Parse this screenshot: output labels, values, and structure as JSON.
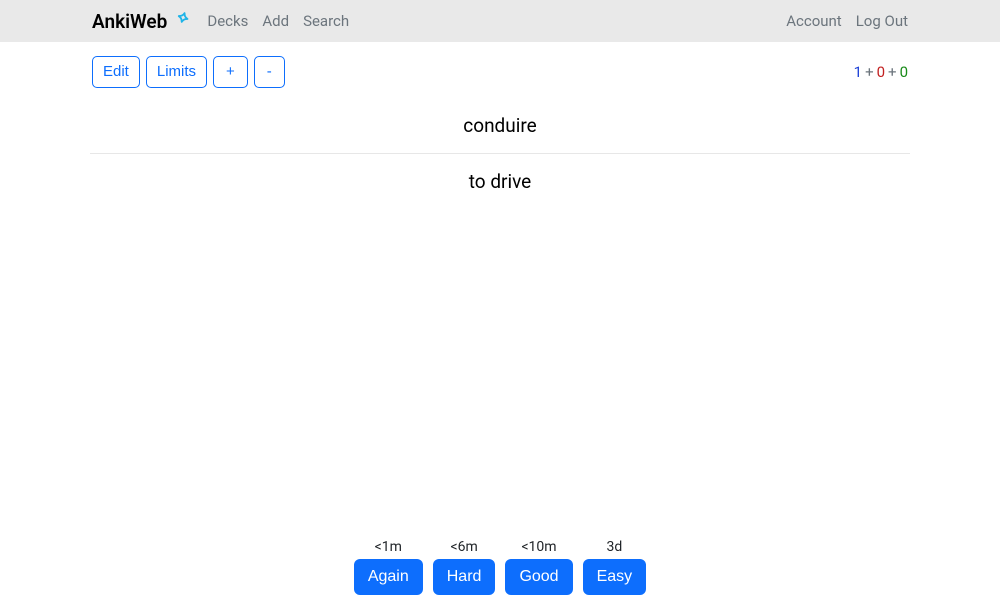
{
  "brand": "AnkiWeb",
  "nav": {
    "decks": "Decks",
    "add": "Add",
    "search": "Search",
    "account": "Account",
    "logout": "Log Out"
  },
  "toolbar": {
    "edit": "Edit",
    "limits": "Limits",
    "plus": "+",
    "minus": "-"
  },
  "counts": {
    "new": "1",
    "learn": "0",
    "due": "0"
  },
  "card": {
    "front": "conduire",
    "back": "to drive"
  },
  "answers": [
    {
      "time": "<1m",
      "label": "Again"
    },
    {
      "time": "<6m",
      "label": "Hard"
    },
    {
      "time": "<10m",
      "label": "Good"
    },
    {
      "time": "3d",
      "label": "Easy"
    }
  ]
}
